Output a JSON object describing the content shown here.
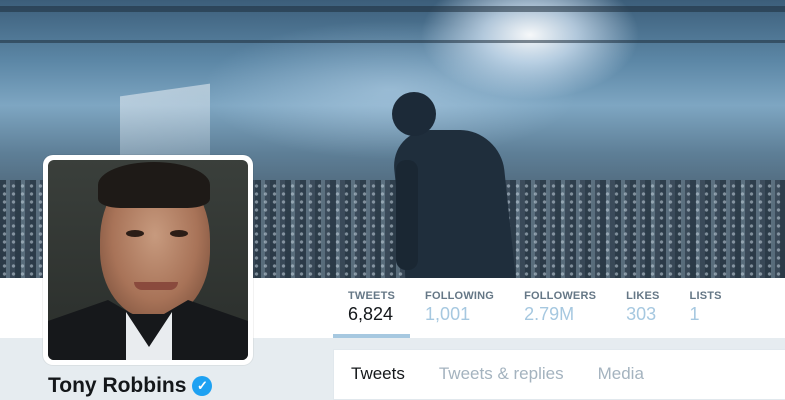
{
  "profile": {
    "name": "Tony Robbins",
    "verified_glyph": "✓"
  },
  "stats": [
    {
      "label": "TWEETS",
      "value": "6,824",
      "active": true
    },
    {
      "label": "FOLLOWING",
      "value": "1,001",
      "active": false
    },
    {
      "label": "FOLLOWERS",
      "value": "2.79M",
      "active": false
    },
    {
      "label": "LIKES",
      "value": "303",
      "active": false
    },
    {
      "label": "LISTS",
      "value": "1",
      "active": false
    }
  ],
  "timeline_tabs": [
    {
      "label": "Tweets",
      "active": true
    },
    {
      "label": "Tweets & replies",
      "active": false
    },
    {
      "label": "Media",
      "active": false
    }
  ],
  "colors": {
    "accent": "#1da1f2",
    "stat_value_inactive": "#a6c8e0",
    "background": "#e6ecf0"
  },
  "icons": {
    "verified": "verified-badge-icon"
  }
}
